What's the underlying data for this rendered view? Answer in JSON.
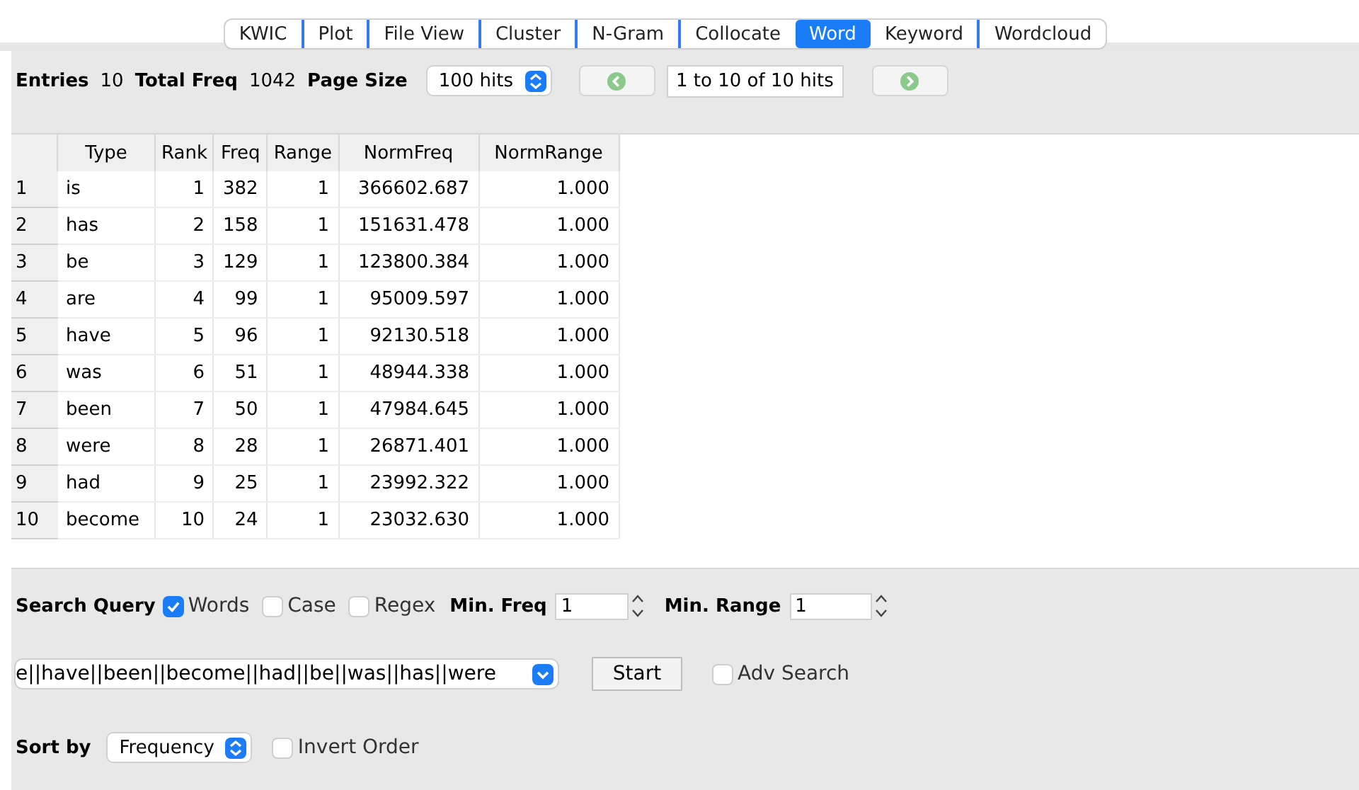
{
  "tabs": [
    {
      "label": "KWIC",
      "selected": false
    },
    {
      "label": "Plot",
      "selected": false
    },
    {
      "label": "File View",
      "selected": false
    },
    {
      "label": "Cluster",
      "selected": false
    },
    {
      "label": "N-Gram",
      "selected": false
    },
    {
      "label": "Collocate",
      "selected": false
    },
    {
      "label": "Word",
      "selected": true
    },
    {
      "label": "Keyword",
      "selected": false
    },
    {
      "label": "Wordcloud",
      "selected": false
    }
  ],
  "summary": {
    "entries_label": "Entries",
    "entries": "10",
    "total_label": "Total Freq",
    "total": "1042",
    "page_size_label": "Page Size",
    "page_size": "100 hits",
    "range": "1 to 10 of 10 hits"
  },
  "table": {
    "columns": [
      "",
      "Type",
      "Rank",
      "Freq",
      "Range",
      "NormFreq",
      "NormRange"
    ],
    "rows": [
      [
        "1",
        "is",
        "1",
        "382",
        "1",
        "366602.687",
        "1.000"
      ],
      [
        "2",
        "has",
        "2",
        "158",
        "1",
        "151631.478",
        "1.000"
      ],
      [
        "3",
        "be",
        "3",
        "129",
        "1",
        "123800.384",
        "1.000"
      ],
      [
        "4",
        "are",
        "4",
        "99",
        "1",
        "95009.597",
        "1.000"
      ],
      [
        "5",
        "have",
        "5",
        "96",
        "1",
        "92130.518",
        "1.000"
      ],
      [
        "6",
        "was",
        "6",
        "51",
        "1",
        "48944.338",
        "1.000"
      ],
      [
        "7",
        "been",
        "7",
        "50",
        "1",
        "47984.645",
        "1.000"
      ],
      [
        "8",
        "were",
        "8",
        "28",
        "1",
        "26871.401",
        "1.000"
      ],
      [
        "9",
        "had",
        "9",
        "25",
        "1",
        "23992.322",
        "1.000"
      ],
      [
        "10",
        "become",
        "10",
        "24",
        "1",
        "23032.630",
        "1.000"
      ]
    ]
  },
  "search": {
    "label": "Search Query",
    "options": [
      {
        "label": "Words",
        "checked": true
      },
      {
        "label": "Case",
        "checked": false
      },
      {
        "label": "Regex",
        "checked": false
      }
    ],
    "min_freq_label": "Min. Freq",
    "min_freq": "1",
    "min_range_label": "Min. Range",
    "min_range": "1",
    "query": "e||have||been||become||had||be||was||has||were",
    "start": "Start",
    "adv": {
      "label": "Adv Search",
      "checked": false
    }
  },
  "sort": {
    "label": "Sort by",
    "value": "Frequency",
    "invert": {
      "label": "Invert Order",
      "checked": false
    }
  }
}
